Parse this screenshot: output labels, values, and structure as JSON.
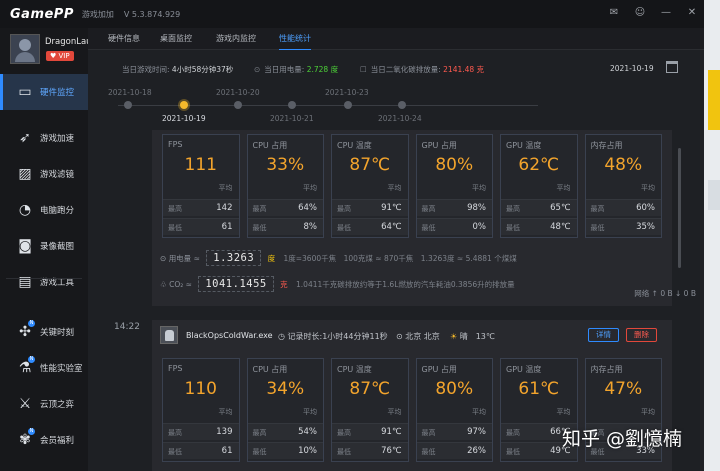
{
  "app": {
    "logo": "GamePP",
    "subtitle": "游戏加加",
    "version": "V 5.3.874.929",
    "window_controls": [
      "✉",
      "☺",
      "—",
      "✕"
    ]
  },
  "user": {
    "name": "DragonLau",
    "vip": "♥ VIP"
  },
  "sidebar": {
    "items": [
      {
        "label": "硬件监控",
        "icon": "monitor-icon",
        "glyph": "▭",
        "active": true
      },
      {
        "label": "游戏加速",
        "icon": "rocket-icon",
        "glyph": "➶"
      },
      {
        "label": "游戏滤镜",
        "icon": "filter-icon",
        "glyph": "▨"
      },
      {
        "label": "电脑跑分",
        "icon": "gauge-icon",
        "glyph": "◔"
      },
      {
        "label": "录像截图",
        "icon": "camera-icon",
        "glyph": "◙"
      },
      {
        "label": "游戏工具",
        "icon": "toolbox-icon",
        "glyph": "▤"
      },
      {
        "label": "关键时刻",
        "icon": "crosshair-icon",
        "glyph": "✣",
        "badge": "N"
      },
      {
        "label": "性能实验室",
        "icon": "lab-flask-icon",
        "glyph": "⚗",
        "badge": "N"
      },
      {
        "label": "云顶之弈",
        "icon": "tft-icon",
        "glyph": "⚔"
      },
      {
        "label": "会员福利",
        "icon": "gift-icon",
        "glyph": "✾",
        "badge": "N"
      }
    ]
  },
  "tabs": [
    {
      "label": "硬件信息"
    },
    {
      "label": "桌面监控"
    },
    {
      "label": "游戏内监控"
    },
    {
      "label": "性能统计",
      "active": true
    }
  ],
  "summary": {
    "game_time_label": "当日游戏时间:",
    "game_time_value": "4小时58分钟37秒",
    "power_label": "当日用电量:",
    "power_value": "2.728 度",
    "co2_label": "当日二氧化碳排放量:",
    "co2_value": "2141.48 克",
    "date": "2021-10-19"
  },
  "timeline": {
    "dates": [
      "2021-10-18",
      "2021-10-19",
      "2021-10-20",
      "2021-10-21",
      "2021-10-23",
      "2021-10-24"
    ],
    "active_date": "2021-10-19"
  },
  "labels": {
    "avg": "平均",
    "max": "最高",
    "min": "最低"
  },
  "session1": {
    "metrics": [
      {
        "name": "FPS",
        "value": "111",
        "max": "142",
        "min": "61"
      },
      {
        "name": "CPU 占用",
        "value": "33%",
        "max": "64%",
        "min": "8%"
      },
      {
        "name": "CPU 温度",
        "value": "87℃",
        "max": "91℃",
        "min": "64℃"
      },
      {
        "name": "GPU 占用",
        "value": "80%",
        "max": "98%",
        "min": "0%"
      },
      {
        "name": "GPU 温度",
        "value": "62℃",
        "max": "65℃",
        "min": "48℃"
      },
      {
        "name": "内存占用",
        "value": "48%",
        "max": "60%",
        "min": "35%"
      }
    ],
    "power": {
      "label": "用电量 ≈",
      "value": "1.3263",
      "unit": "度",
      "note": "1度=3600千焦　100克煤 ≈ 870千焦　1.3263度 ≈ 5.4881 个煤煤"
    },
    "co2": {
      "label": "CO₂ ≈",
      "value": "1041.1455",
      "unit": "克",
      "note": "1.0411千克碳排放约等于1.6L燃放的汽车耗油0.3856升的排放量"
    },
    "network": "网络 ↑ 0 B ↓ 0 B"
  },
  "session2": {
    "time": "14:22",
    "game": "BlackOpsColdWar.exe",
    "duration": "◷ 记录时长:1小时44分钟11秒",
    "location": "⊙ 北京 北京",
    "weather_icon": "☀",
    "weather": "晴　13℃",
    "detail_button": "详情",
    "delete_button": "删除",
    "metrics": [
      {
        "name": "FPS",
        "value": "110",
        "max": "139",
        "min": "61"
      },
      {
        "name": "CPU 占用",
        "value": "34%",
        "max": "54%",
        "min": "10%"
      },
      {
        "name": "CPU 温度",
        "value": "87℃",
        "max": "91℃",
        "min": "76℃"
      },
      {
        "name": "GPU 占用",
        "value": "80%",
        "max": "97%",
        "min": "26%"
      },
      {
        "name": "GPU 温度",
        "value": "61℃",
        "max": "66℃",
        "min": "49℃"
      },
      {
        "name": "内存占用",
        "value": "47%",
        "max": "",
        "min": "33%"
      }
    ]
  },
  "watermark": "知乎 @劉憶楠"
}
